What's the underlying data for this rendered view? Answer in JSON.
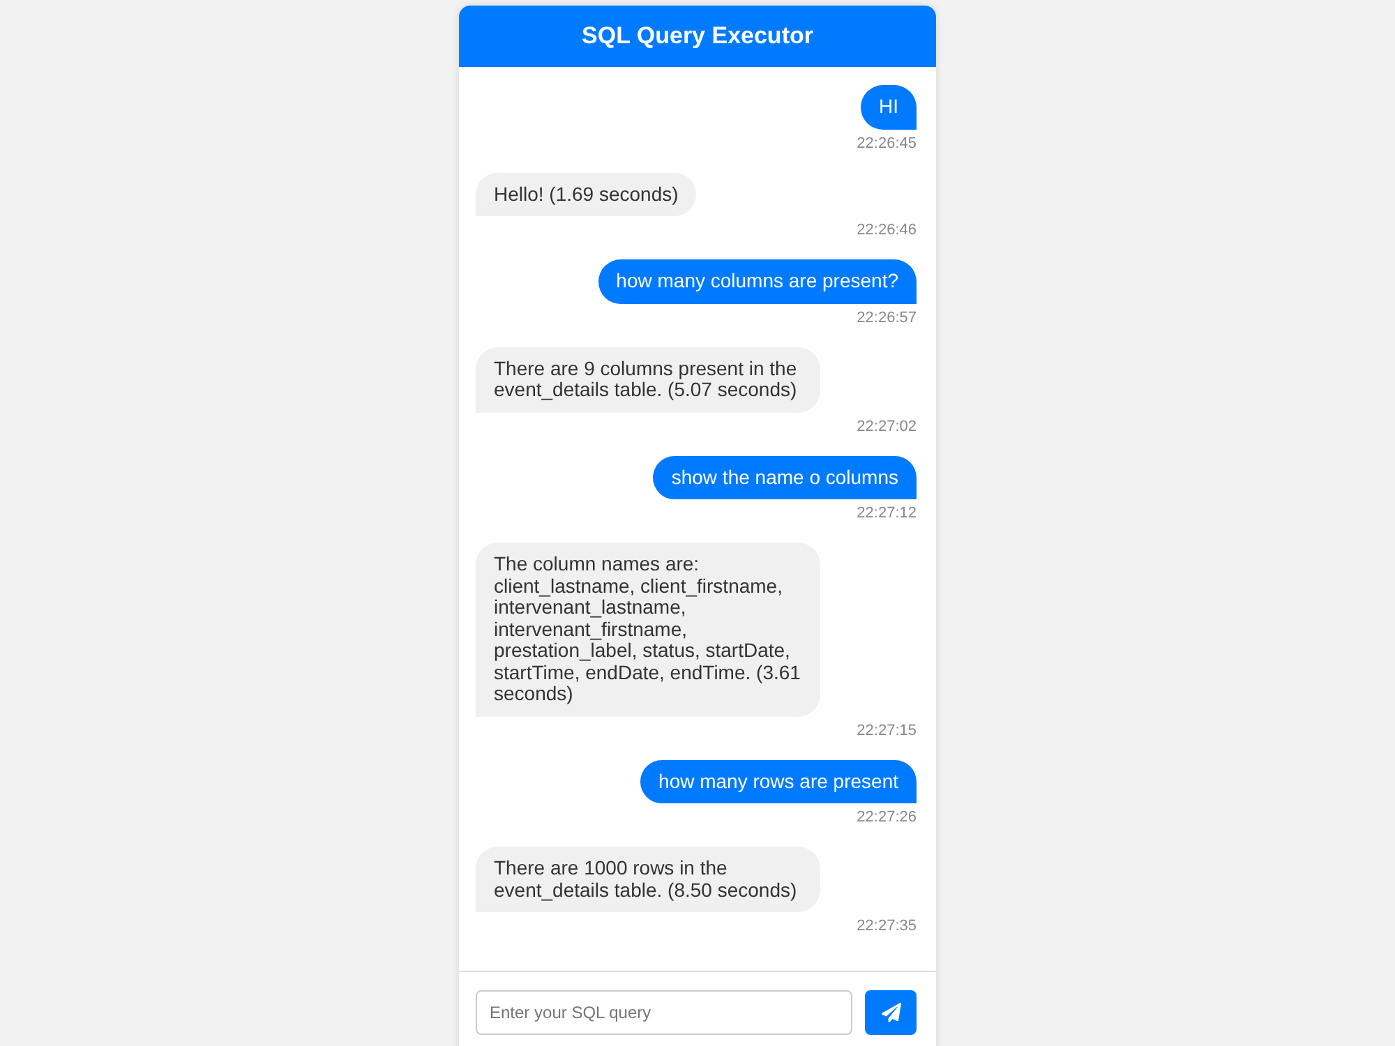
{
  "header": {
    "title": "SQL Query Executor"
  },
  "messages": [
    {
      "kind": "user",
      "text": "HI",
      "time": "22:26:45"
    },
    {
      "kind": "bot",
      "text": "Hello! (1.69 seconds)",
      "time": "22:26:46"
    },
    {
      "kind": "user",
      "text": "how many columns are present?",
      "time": "22:26:57"
    },
    {
      "kind": "bot",
      "text": "There are 9 columns present in the event_details table. (5.07 seconds)",
      "time": "22:27:02"
    },
    {
      "kind": "user",
      "text": "show the name o columns",
      "time": "22:27:12"
    },
    {
      "kind": "bot",
      "text": "The column names are: client_lastname, client_firstname, intervenant_lastname, intervenant_firstname, prestation_label, status, startDate, startTime, endDate, endTime. (3.61 seconds)",
      "time": "22:27:15"
    },
    {
      "kind": "user",
      "text": "how many rows are present",
      "time": "22:27:26"
    },
    {
      "kind": "bot",
      "text": "There are 1000 rows in the event_details table. (8.50 seconds)",
      "time": "22:27:35"
    }
  ],
  "composer": {
    "placeholder": "Enter your SQL query"
  }
}
